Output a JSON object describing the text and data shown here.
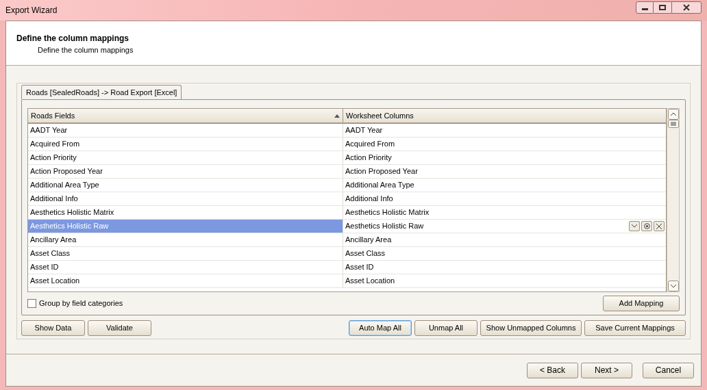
{
  "window": {
    "title": "Export Wizard"
  },
  "header": {
    "title": "Define the column mappings",
    "subtitle": "Define the column mappings"
  },
  "tabs": [
    {
      "label": "Roads [SealedRoads] -> Road Export [Excel]",
      "selected": true
    }
  ],
  "table": {
    "columns": [
      {
        "label": "Roads Fields",
        "sorted_ascending": true
      },
      {
        "label": "Worksheet Columns",
        "sorted_ascending": false
      }
    ],
    "rows": [
      {
        "field": "AADT Year",
        "column": "AADT Year",
        "selected": false
      },
      {
        "field": "Acquired From",
        "column": "Acquired From",
        "selected": false
      },
      {
        "field": "Action Priority",
        "column": "Action Priority",
        "selected": false
      },
      {
        "field": "Action Proposed Year",
        "column": "Action Proposed Year",
        "selected": false
      },
      {
        "field": "Additional Area Type",
        "column": "Additional Area Type",
        "selected": false
      },
      {
        "field": "Additional Info",
        "column": "Additional Info",
        "selected": false
      },
      {
        "field": "Aesthetics Holistic Matrix",
        "column": "Aesthetics Holistic Matrix",
        "selected": false
      },
      {
        "field": "Aesthetics Holistic Raw",
        "column": "Aesthetics Holistic Raw",
        "selected": true
      },
      {
        "field": "Ancillary Area",
        "column": "Ancillary Area",
        "selected": false
      },
      {
        "field": "Asset Class",
        "column": "Asset Class",
        "selected": false
      },
      {
        "field": "Asset ID",
        "column": "Asset ID",
        "selected": false
      },
      {
        "field": "Asset Location",
        "column": "Asset Location",
        "selected": false
      }
    ]
  },
  "group_by": {
    "label": "Group by field categories",
    "checked": false
  },
  "add_mapping": "Add Mapping",
  "toolbar_left": [
    {
      "label": "Show Data",
      "focused": false
    },
    {
      "label": "Validate",
      "focused": false
    }
  ],
  "toolbar_right": [
    {
      "label": "Auto Map All",
      "focused": true
    },
    {
      "label": "Unmap All",
      "focused": false
    },
    {
      "label": "Show Unmapped Columns",
      "focused": false
    },
    {
      "label": "Save Current Mappings",
      "focused": false
    }
  ],
  "footer_buttons": [
    "< Back",
    "Next >",
    "Cancel"
  ]
}
